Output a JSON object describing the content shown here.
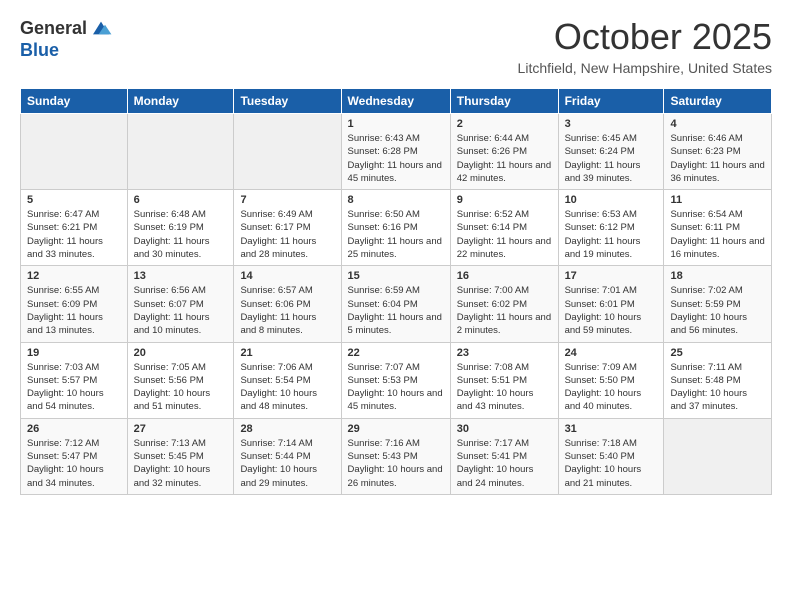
{
  "header": {
    "logo_general": "General",
    "logo_blue": "Blue",
    "month": "October 2025",
    "location": "Litchfield, New Hampshire, United States"
  },
  "weekdays": [
    "Sunday",
    "Monday",
    "Tuesday",
    "Wednesday",
    "Thursday",
    "Friday",
    "Saturday"
  ],
  "weeks": [
    [
      {
        "day": "",
        "info": ""
      },
      {
        "day": "",
        "info": ""
      },
      {
        "day": "",
        "info": ""
      },
      {
        "day": "1",
        "info": "Sunrise: 6:43 AM\nSunset: 6:28 PM\nDaylight: 11 hours and 45 minutes."
      },
      {
        "day": "2",
        "info": "Sunrise: 6:44 AM\nSunset: 6:26 PM\nDaylight: 11 hours and 42 minutes."
      },
      {
        "day": "3",
        "info": "Sunrise: 6:45 AM\nSunset: 6:24 PM\nDaylight: 11 hours and 39 minutes."
      },
      {
        "day": "4",
        "info": "Sunrise: 6:46 AM\nSunset: 6:23 PM\nDaylight: 11 hours and 36 minutes."
      }
    ],
    [
      {
        "day": "5",
        "info": "Sunrise: 6:47 AM\nSunset: 6:21 PM\nDaylight: 11 hours and 33 minutes."
      },
      {
        "day": "6",
        "info": "Sunrise: 6:48 AM\nSunset: 6:19 PM\nDaylight: 11 hours and 30 minutes."
      },
      {
        "day": "7",
        "info": "Sunrise: 6:49 AM\nSunset: 6:17 PM\nDaylight: 11 hours and 28 minutes."
      },
      {
        "day": "8",
        "info": "Sunrise: 6:50 AM\nSunset: 6:16 PM\nDaylight: 11 hours and 25 minutes."
      },
      {
        "day": "9",
        "info": "Sunrise: 6:52 AM\nSunset: 6:14 PM\nDaylight: 11 hours and 22 minutes."
      },
      {
        "day": "10",
        "info": "Sunrise: 6:53 AM\nSunset: 6:12 PM\nDaylight: 11 hours and 19 minutes."
      },
      {
        "day": "11",
        "info": "Sunrise: 6:54 AM\nSunset: 6:11 PM\nDaylight: 11 hours and 16 minutes."
      }
    ],
    [
      {
        "day": "12",
        "info": "Sunrise: 6:55 AM\nSunset: 6:09 PM\nDaylight: 11 hours and 13 minutes."
      },
      {
        "day": "13",
        "info": "Sunrise: 6:56 AM\nSunset: 6:07 PM\nDaylight: 11 hours and 10 minutes."
      },
      {
        "day": "14",
        "info": "Sunrise: 6:57 AM\nSunset: 6:06 PM\nDaylight: 11 hours and 8 minutes."
      },
      {
        "day": "15",
        "info": "Sunrise: 6:59 AM\nSunset: 6:04 PM\nDaylight: 11 hours and 5 minutes."
      },
      {
        "day": "16",
        "info": "Sunrise: 7:00 AM\nSunset: 6:02 PM\nDaylight: 11 hours and 2 minutes."
      },
      {
        "day": "17",
        "info": "Sunrise: 7:01 AM\nSunset: 6:01 PM\nDaylight: 10 hours and 59 minutes."
      },
      {
        "day": "18",
        "info": "Sunrise: 7:02 AM\nSunset: 5:59 PM\nDaylight: 10 hours and 56 minutes."
      }
    ],
    [
      {
        "day": "19",
        "info": "Sunrise: 7:03 AM\nSunset: 5:57 PM\nDaylight: 10 hours and 54 minutes."
      },
      {
        "day": "20",
        "info": "Sunrise: 7:05 AM\nSunset: 5:56 PM\nDaylight: 10 hours and 51 minutes."
      },
      {
        "day": "21",
        "info": "Sunrise: 7:06 AM\nSunset: 5:54 PM\nDaylight: 10 hours and 48 minutes."
      },
      {
        "day": "22",
        "info": "Sunrise: 7:07 AM\nSunset: 5:53 PM\nDaylight: 10 hours and 45 minutes."
      },
      {
        "day": "23",
        "info": "Sunrise: 7:08 AM\nSunset: 5:51 PM\nDaylight: 10 hours and 43 minutes."
      },
      {
        "day": "24",
        "info": "Sunrise: 7:09 AM\nSunset: 5:50 PM\nDaylight: 10 hours and 40 minutes."
      },
      {
        "day": "25",
        "info": "Sunrise: 7:11 AM\nSunset: 5:48 PM\nDaylight: 10 hours and 37 minutes."
      }
    ],
    [
      {
        "day": "26",
        "info": "Sunrise: 7:12 AM\nSunset: 5:47 PM\nDaylight: 10 hours and 34 minutes."
      },
      {
        "day": "27",
        "info": "Sunrise: 7:13 AM\nSunset: 5:45 PM\nDaylight: 10 hours and 32 minutes."
      },
      {
        "day": "28",
        "info": "Sunrise: 7:14 AM\nSunset: 5:44 PM\nDaylight: 10 hours and 29 minutes."
      },
      {
        "day": "29",
        "info": "Sunrise: 7:16 AM\nSunset: 5:43 PM\nDaylight: 10 hours and 26 minutes."
      },
      {
        "day": "30",
        "info": "Sunrise: 7:17 AM\nSunset: 5:41 PM\nDaylight: 10 hours and 24 minutes."
      },
      {
        "day": "31",
        "info": "Sunrise: 7:18 AM\nSunset: 5:40 PM\nDaylight: 10 hours and 21 minutes."
      },
      {
        "day": "",
        "info": ""
      }
    ]
  ]
}
